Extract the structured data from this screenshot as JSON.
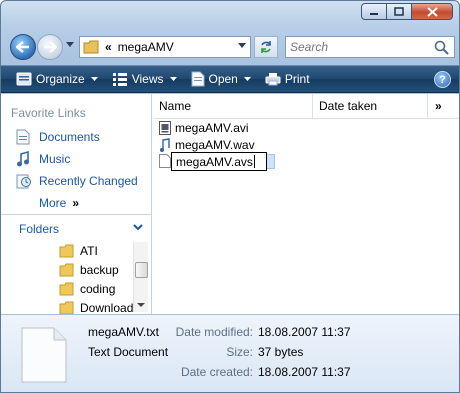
{
  "window": {
    "caption_buttons": [
      "minimize",
      "maximize",
      "close"
    ]
  },
  "address": {
    "path_chevron": "«",
    "path": "megaAMV"
  },
  "search": {
    "placeholder": "Search"
  },
  "toolbar": {
    "organize": "Organize",
    "views": "Views",
    "open": "Open",
    "print": "Print",
    "help": "?"
  },
  "nav": {
    "favorite_title": "Favorite Links",
    "favorites": [
      {
        "label": "Documents",
        "icon": "documents-icon"
      },
      {
        "label": "Music",
        "icon": "music-icon"
      },
      {
        "label": "Recently Changed",
        "icon": "recently-changed-icon"
      }
    ],
    "more": "More",
    "more_glyph": "»",
    "folders_label": "Folders",
    "folders": [
      "ATI",
      "backup",
      "coding",
      "Download"
    ]
  },
  "files": {
    "columns": {
      "name": "Name",
      "date": "Date taken",
      "overflow": "»"
    },
    "items": [
      {
        "name": "megaAMV.avi",
        "icon": "video-file-icon"
      },
      {
        "name": "megaAMV.wav",
        "icon": "audio-file-icon"
      }
    ],
    "rename_value": "megaAMV.avs"
  },
  "details": {
    "name": "megaAMV.txt",
    "type": "Text Document",
    "modified_label": "Date modified:",
    "modified": "18.08.2007 11:37",
    "size_label": "Size:",
    "size": "37 bytes",
    "created_label": "Date created:",
    "created": "18.08.2007 11:37"
  },
  "colors": {
    "link": "#1a58a8",
    "toolbar": "#1f4870",
    "frame": "#b6cde6"
  }
}
